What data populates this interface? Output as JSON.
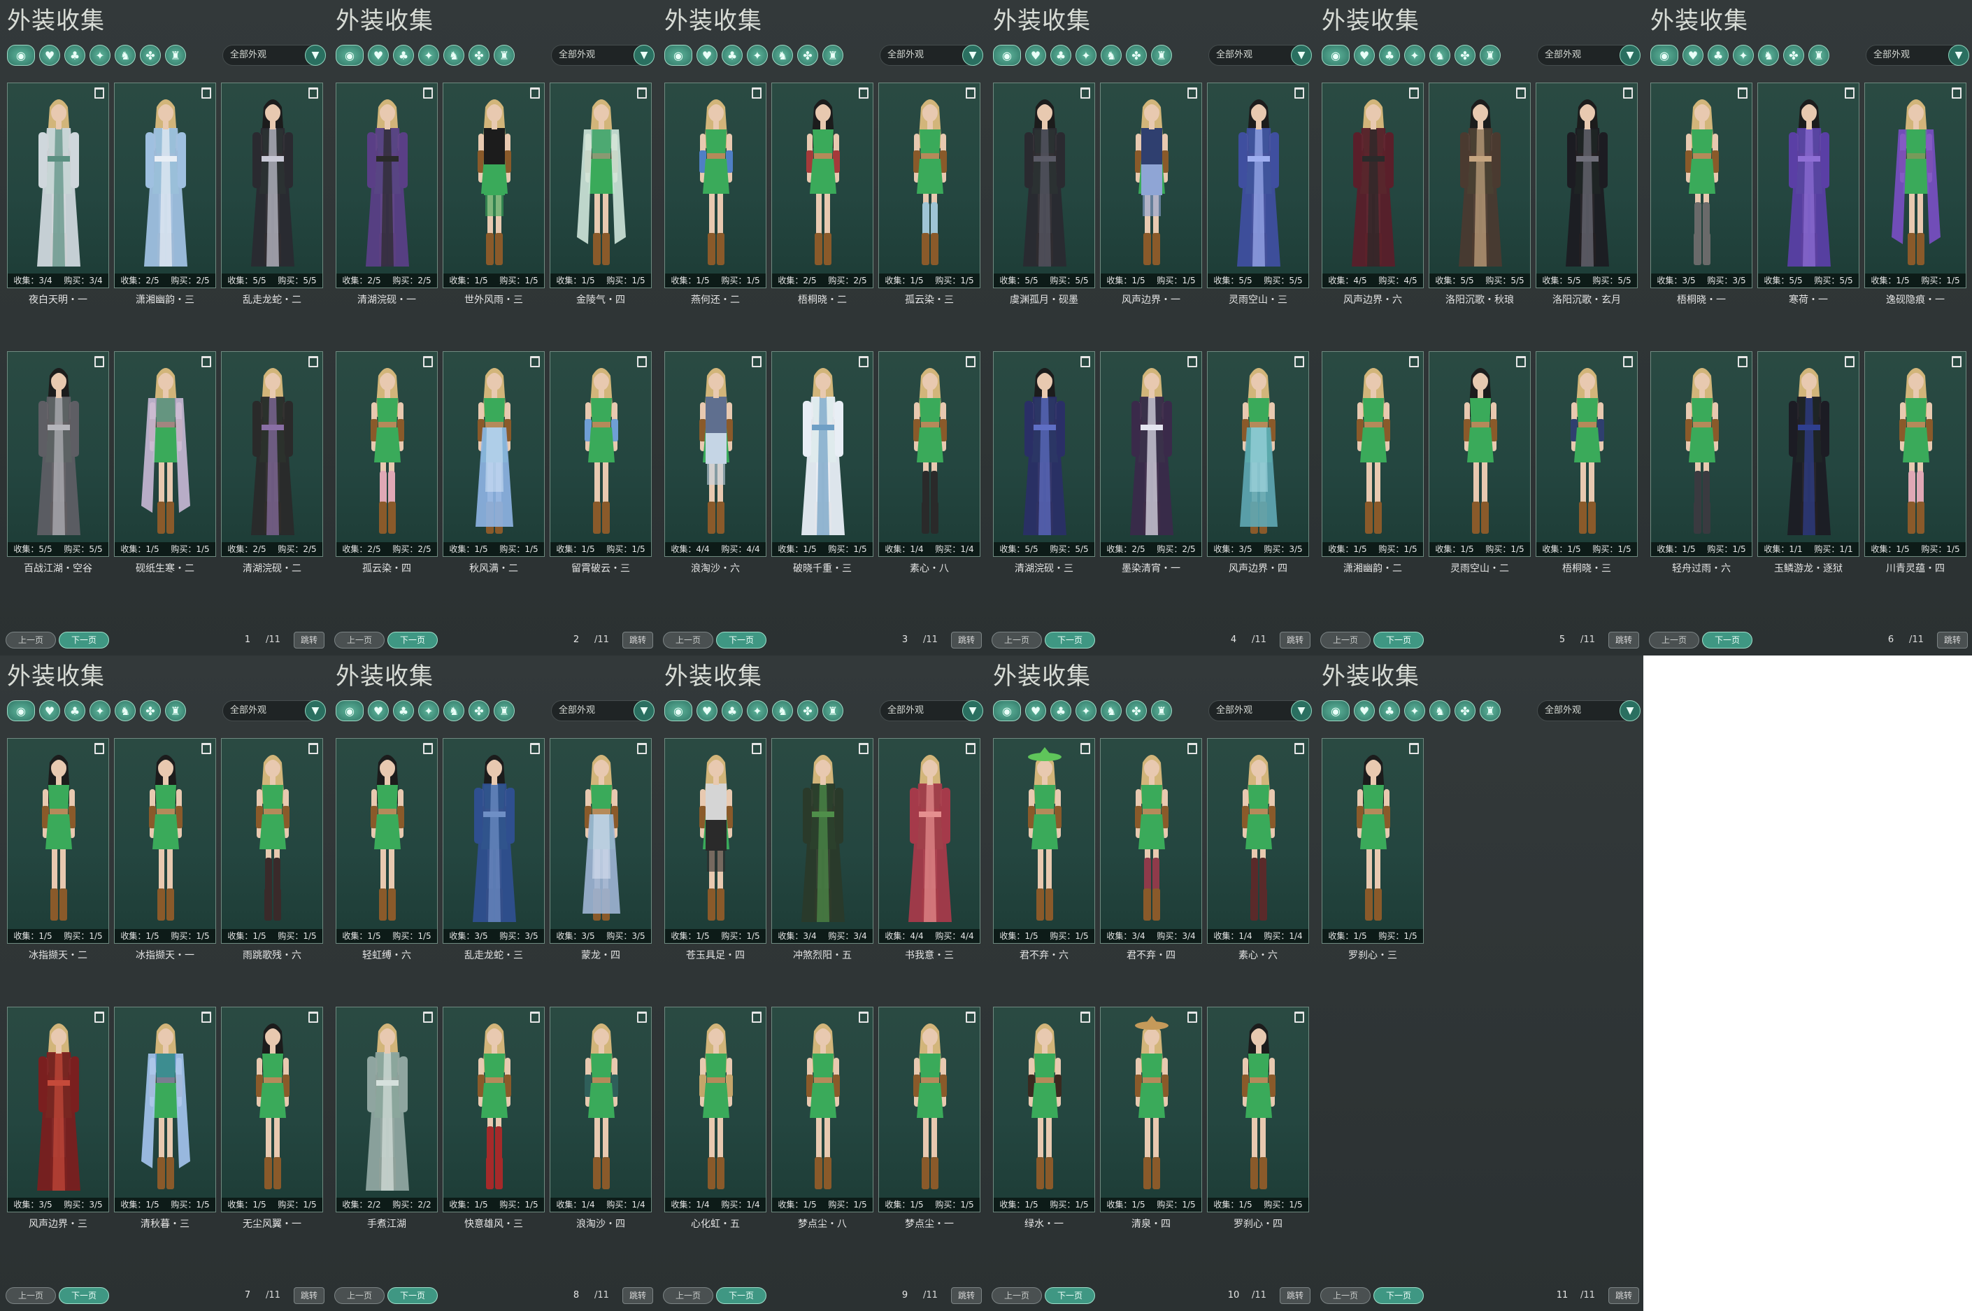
{
  "title": "外装收集",
  "filter_label": "全部外观",
  "filter_arrow": "▼",
  "tab_icons": [
    "all-appearance-icon",
    "top-clothing-icon",
    "chest-armor-icon",
    "lower-clothing-icon",
    "bracer-icon",
    "belt-icon",
    "boots-icon"
  ],
  "tab_glyphs": [
    "◉",
    "♥",
    "♣",
    "✦",
    "♞",
    "✤",
    "♜"
  ],
  "stat_collect_prefix": "收集：",
  "stat_buy_prefix": "购买：",
  "prev_label": "上一页",
  "next_label": "下一页",
  "jump_label": "跳转",
  "total_label": "/11",
  "colors": {
    "accent": "#3f9783",
    "panel_bg": "#2f3536",
    "card_bg": "#244640",
    "card_border": "#6f8a80",
    "text": "#e4e4e4"
  },
  "pages": [
    {
      "page": "1",
      "items": [
        {
          "name": "夜白天明・一",
          "collect": "3/4",
          "buy": "3/4",
          "hair": "#d2b57a",
          "coat": "#cfd7dc",
          "accent": "#5a8f80",
          "style": "robe"
        },
        {
          "name": "潇湘幽韵・三",
          "collect": "2/5",
          "buy": "2/5",
          "hair": "#d2b57a",
          "coat": "#9fc0e0",
          "accent": "#e8eef5",
          "style": "robe"
        },
        {
          "name": "乱走龙蛇・二",
          "collect": "5/5",
          "buy": "5/5",
          "hair": "#1c1c1c",
          "coat": "#2a2a30",
          "accent": "#c9c9d6",
          "style": "robe"
        },
        {
          "name": "百战江湖・空谷",
          "collect": "5/5",
          "buy": "5/5",
          "hair": "#1c1c1c",
          "coat": "#5e5e64",
          "accent": "#b5b5bb",
          "style": "robe"
        },
        {
          "name": "砚纸生寒・二",
          "collect": "1/5",
          "buy": "1/5",
          "hair": "#d2b57a",
          "coat": "#8f7fa6",
          "accent": "#c9b9d6",
          "style": "shawl"
        },
        {
          "name": "清湖浣砚・二",
          "collect": "2/5",
          "buy": "2/5",
          "hair": "#d2b57a",
          "coat": "#2a2a2a",
          "accent": "#8a6fa5",
          "style": "robe"
        }
      ]
    },
    {
      "page": "2",
      "items": [
        {
          "name": "清湖浣砚・一",
          "collect": "2/5",
          "buy": "2/5",
          "hair": "#d2b57a",
          "coat": "#5a3f86",
          "accent": "#2a2a2a",
          "style": "robe"
        },
        {
          "name": "世外风雨・三",
          "collect": "1/5",
          "buy": "1/5",
          "hair": "#d2b57a",
          "coat": "#1c1c1c",
          "accent": "#3aaa5a",
          "style": "shorts"
        },
        {
          "name": "金陵气・四",
          "collect": "1/5",
          "buy": "1/5",
          "hair": "#d2b57a",
          "coat": "#5fa88a",
          "accent": "#cfe5da",
          "style": "shawl"
        },
        {
          "name": "孤云染・四",
          "collect": "2/5",
          "buy": "2/5",
          "hair": "#d2b57a",
          "coat": "#3aaa5a",
          "accent": "#e0a8b5",
          "style": "stockings"
        },
        {
          "name": "秋风满・二",
          "collect": "1/5",
          "buy": "1/5",
          "hair": "#d2b57a",
          "coat": "#8fb5e5",
          "accent": "#d8e8f8",
          "style": "skirt"
        },
        {
          "name": "留霄破云・三",
          "collect": "1/5",
          "buy": "1/5",
          "hair": "#d2b57a",
          "coat": "#3aaa5a",
          "accent": "#6f9fd5",
          "style": "sleeves"
        }
      ]
    },
    {
      "page": "3",
      "items": [
        {
          "name": "燕何还・二",
          "collect": "1/5",
          "buy": "1/5",
          "hair": "#d2b57a",
          "coat": "#3aaa5a",
          "accent": "#4f7fc5",
          "style": "sleeves"
        },
        {
          "name": "梧桐晓・二",
          "collect": "2/5",
          "buy": "2/5",
          "hair": "#1c1c1c",
          "coat": "#3aaa5a",
          "accent": "#a53a3a",
          "style": "sleeves"
        },
        {
          "name": "孤云染・三",
          "collect": "1/5",
          "buy": "1/5",
          "hair": "#d2b57a",
          "coat": "#3aaa5a",
          "accent": "#9fc5d5",
          "style": "stockings"
        },
        {
          "name": "浪淘沙・六",
          "collect": "4/4",
          "buy": "4/4",
          "hair": "#d2b57a",
          "coat": "#5f6f8f",
          "accent": "#c5d5e5",
          "style": "shorts"
        },
        {
          "name": "破晓千重・三",
          "collect": "1/5",
          "buy": "1/5",
          "hair": "#d2b57a",
          "coat": "#e8eef5",
          "accent": "#6f9fc5",
          "style": "robe"
        },
        {
          "name": "素心・八",
          "collect": "1/4",
          "buy": "1/4",
          "hair": "#d2b57a",
          "coat": "#3aaa5a",
          "accent": "#2a2a2a",
          "style": "boots"
        }
      ]
    },
    {
      "page": "4",
      "items": [
        {
          "name": "虞渊孤月・砚墨",
          "collect": "5/5",
          "buy": "5/5",
          "hair": "#1c1c1c",
          "coat": "#2a2a30",
          "accent": "#5a5a66",
          "style": "robe"
        },
        {
          "name": "风声边界・一",
          "collect": "1/5",
          "buy": "1/5",
          "hair": "#d2b57a",
          "coat": "#2f3f6f",
          "accent": "#8fa5d5",
          "style": "shorts"
        },
        {
          "name": "灵雨空山・三",
          "collect": "5/5",
          "buy": "5/5",
          "hair": "#1c1c1c",
          "coat": "#3f4f9f",
          "accent": "#9faff0",
          "style": "robe"
        },
        {
          "name": "清湖浣砚・三",
          "collect": "5/5",
          "buy": "5/5",
          "hair": "#1c1c1c",
          "coat": "#2a2f66",
          "accent": "#5f6fc5",
          "style": "robe"
        },
        {
          "name": "墨染清宵・一",
          "collect": "2/5",
          "buy": "2/5",
          "hair": "#d2b57a",
          "coat": "#3a2a4a",
          "accent": "#e5e5f0",
          "style": "robe"
        },
        {
          "name": "风声边界・四",
          "collect": "3/5",
          "buy": "3/5",
          "hair": "#d2b57a",
          "coat": "#5fa8b5",
          "accent": "#b5e5ef",
          "style": "skirt"
        }
      ]
    },
    {
      "page": "5",
      "items": [
        {
          "name": "风声边界・六",
          "collect": "4/5",
          "buy": "4/5",
          "hair": "#d2b57a",
          "coat": "#5a1f2a",
          "accent": "#2a2a2a",
          "style": "robe"
        },
        {
          "name": "洛阳沉歌・秋琅",
          "collect": "5/5",
          "buy": "5/5",
          "hair": "#1c1c1c",
          "coat": "#4a3a30",
          "accent": "#c5a580",
          "style": "robe"
        },
        {
          "name": "洛阳沉歌・玄月",
          "collect": "5/5",
          "buy": "5/5",
          "hair": "#1c1c1c",
          "coat": "#1c1c22",
          "accent": "#6f6f7a",
          "style": "robe"
        },
        {
          "name": "潇湘幽韵・二",
          "collect": "1/5",
          "buy": "1/5",
          "hair": "#d2b57a",
          "coat": "#3aaa5a",
          "accent": "#3aaa5a",
          "style": "base"
        },
        {
          "name": "灵雨空山・二",
          "collect": "1/5",
          "buy": "1/5",
          "hair": "#1c1c1c",
          "coat": "#3aaa5a",
          "accent": "#3aaa5a",
          "style": "base"
        },
        {
          "name": "梧桐晓・三",
          "collect": "1/5",
          "buy": "1/5",
          "hair": "#d2b57a",
          "coat": "#3aaa5a",
          "accent": "#2f3f6f",
          "style": "sleeves"
        }
      ]
    },
    {
      "page": "6",
      "items": [
        {
          "name": "梧桐晓・一",
          "collect": "3/5",
          "buy": "3/5",
          "hair": "#d2b57a",
          "coat": "#3aaa5a",
          "accent": "#6a6a6a",
          "style": "boots"
        },
        {
          "name": "寒荷・一",
          "collect": "5/5",
          "buy": "5/5",
          "hair": "#1c1c1c",
          "coat": "#5a3fa5",
          "accent": "#8f6fd5",
          "style": "robe"
        },
        {
          "name": "逸砚隐痕・一",
          "collect": "1/5",
          "buy": "1/5",
          "hair": "#d2b57a",
          "coat": "#3aaa5a",
          "accent": "#7a4fc5",
          "style": "shawl"
        },
        {
          "name": "轻舟过雨・六",
          "collect": "1/5",
          "buy": "1/5",
          "hair": "#d2b57a",
          "coat": "#3aaa5a",
          "accent": "#3a3a40",
          "style": "boots"
        },
        {
          "name": "玉鳞游龙・逐狱",
          "collect": "1/1",
          "buy": "1/1",
          "hair": "#d2b57a",
          "coat": "#1c1c24",
          "accent": "#2f3f8f",
          "style": "robe"
        },
        {
          "name": "川青灵蕴・四",
          "collect": "1/5",
          "buy": "1/5",
          "hair": "#d2b57a",
          "coat": "#3aaa5a",
          "accent": "#e0a8b5",
          "style": "stockings"
        }
      ]
    },
    {
      "page": "7",
      "items": [
        {
          "name": "冰指撷天・二",
          "collect": "1/5",
          "buy": "1/5",
          "hair": "#1c1c1c",
          "coat": "#3aaa5a",
          "accent": "#3aaa5a",
          "style": "base"
        },
        {
          "name": "冰指撷天・一",
          "collect": "1/5",
          "buy": "1/5",
          "hair": "#1c1c1c",
          "coat": "#3aaa5a",
          "accent": "#3aaa5a",
          "style": "base"
        },
        {
          "name": "雨跳歌残・六",
          "collect": "1/5",
          "buy": "1/5",
          "hair": "#d2b57a",
          "coat": "#3aaa5a",
          "accent": "#3a2a2a",
          "style": "boots"
        },
        {
          "name": "风声边界・三",
          "collect": "3/5",
          "buy": "3/5",
          "hair": "#d2b57a",
          "coat": "#7a1f1f",
          "accent": "#c54a3a",
          "style": "robe"
        },
        {
          "name": "清秋暮・三",
          "collect": "1/5",
          "buy": "1/5",
          "hair": "#d2b57a",
          "coat": "#3f6fc5",
          "accent": "#a5c5f0",
          "style": "shawl"
        },
        {
          "name": "无尘风翼・一",
          "collect": "1/5",
          "buy": "1/5",
          "hair": "#1c1c1c",
          "coat": "#3aaa5a",
          "accent": "#3aaa5a",
          "style": "base"
        }
      ]
    },
    {
      "page": "8",
      "items": [
        {
          "name": "轻虹缚・六",
          "collect": "1/5",
          "buy": "1/5",
          "hair": "#1c1c1c",
          "coat": "#3aaa5a",
          "accent": "#3aaa5a",
          "style": "base"
        },
        {
          "name": "乱走龙蛇・三",
          "collect": "3/5",
          "buy": "3/5",
          "hair": "#1c1c1c",
          "coat": "#2f4f8f",
          "accent": "#6f8fc5",
          "style": "robe"
        },
        {
          "name": "蒙龙・四",
          "collect": "3/5",
          "buy": "3/5",
          "hair": "#d2b57a",
          "coat": "#9fb5d5",
          "accent": "#dfe8f5",
          "style": "skirt"
        },
        {
          "name": "手煮江湖",
          "collect": "2/2",
          "buy": "2/2",
          "hair": "#d2b57a",
          "coat": "#8fa5a0",
          "accent": "#d5e0dc",
          "style": "robe"
        },
        {
          "name": "快意雄风・三",
          "collect": "1/5",
          "buy": "1/5",
          "hair": "#d2b57a",
          "coat": "#3aaa5a",
          "accent": "#a52a2a",
          "style": "boots"
        },
        {
          "name": "浪淘沙・四",
          "collect": "1/4",
          "buy": "1/4",
          "hair": "#d2b57a",
          "coat": "#3aaa5a",
          "accent": "#2f5f5a",
          "style": "sleeves"
        }
      ]
    },
    {
      "page": "9",
      "items": [
        {
          "name": "苍玉具足・四",
          "collect": "1/5",
          "buy": "1/5",
          "hair": "#d2b57a",
          "coat": "#d5d5d5",
          "accent": "#2a2a2a",
          "style": "shorts"
        },
        {
          "name": "冲煞烈阳・五",
          "collect": "3/4",
          "buy": "3/4",
          "hair": "#d2b57a",
          "coat": "#2a3a2a",
          "accent": "#4f8f4a",
          "style": "robe"
        },
        {
          "name": "书我意・三",
          "collect": "4/4",
          "buy": "4/4",
          "hair": "#d2b57a",
          "coat": "#a53a4a",
          "accent": "#e58f8f",
          "style": "robe"
        },
        {
          "name": "心化虹・五",
          "collect": "1/4",
          "buy": "1/4",
          "hair": "#d2b57a",
          "coat": "#3aaa5a",
          "accent": "#c5a56a",
          "style": "sleeves"
        },
        {
          "name": "梦点尘・八",
          "collect": "1/5",
          "buy": "1/5",
          "hair": "#d2b57a",
          "coat": "#3aaa5a",
          "accent": "#3aaa5a",
          "style": "base"
        },
        {
          "name": "梦点尘・一",
          "collect": "1/5",
          "buy": "1/5",
          "hair": "#d2b57a",
          "coat": "#3aaa5a",
          "accent": "#3aaa5a",
          "style": "base"
        }
      ]
    },
    {
      "page": "10",
      "items": [
        {
          "name": "君不弃・六",
          "collect": "1/5",
          "buy": "1/5",
          "hair": "#d2b57a",
          "coat": "#3aaa5a",
          "accent": "#5fc55a",
          "style": "hat"
        },
        {
          "name": "君不弃・四",
          "collect": "3/4",
          "buy": "3/4",
          "hair": "#d2b57a",
          "coat": "#d5a5b5",
          "accent": "#8f3a4a",
          "style": "stockings"
        },
        {
          "name": "素心・六",
          "collect": "1/4",
          "buy": "1/4",
          "hair": "#d2b57a",
          "coat": "#3aaa5a",
          "accent": "#5a2a2a",
          "style": "boots"
        },
        {
          "name": "绿水・一",
          "collect": "1/5",
          "buy": "1/5",
          "hair": "#d2b57a",
          "coat": "#3aaa5a",
          "accent": "#3a2a20",
          "style": "sleeves"
        },
        {
          "name": "清泉・四",
          "collect": "1/5",
          "buy": "1/5",
          "hair": "#d2b57a",
          "coat": "#3aaa5a",
          "accent": "#c59a5a",
          "style": "hat"
        },
        {
          "name": "罗刹心・四",
          "collect": "1/5",
          "buy": "1/5",
          "hair": "#1c1c1c",
          "coat": "#3aaa5a",
          "accent": "#3aaa5a",
          "style": "base"
        }
      ]
    },
    {
      "page": "11",
      "items": [
        {
          "name": "罗刹心・三",
          "collect": "1/5",
          "buy": "1/5",
          "hair": "#1c1c1c",
          "coat": "#3aaa5a",
          "accent": "#3aaa5a",
          "style": "base"
        }
      ]
    }
  ]
}
